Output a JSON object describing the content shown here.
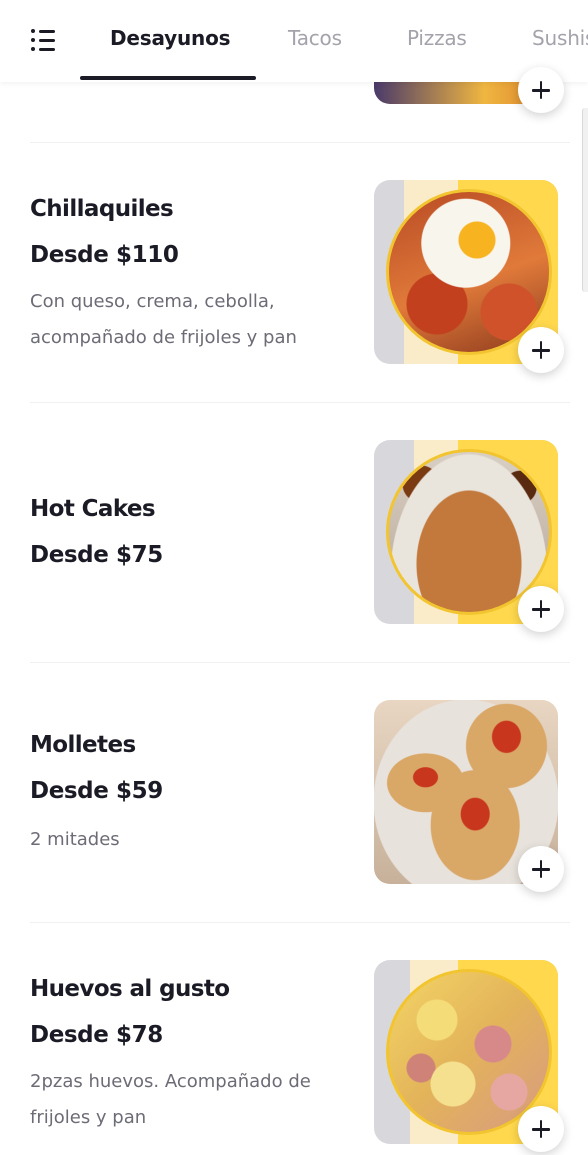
{
  "nav": {
    "tabs": [
      {
        "label": "Desayunos",
        "active": true
      },
      {
        "label": "Tacos",
        "active": false
      },
      {
        "label": "Pizzas",
        "active": false
      },
      {
        "label": "Sushis",
        "active": false
      }
    ]
  },
  "items": [
    {
      "name": "Chillaquiles",
      "price": "Desde $110",
      "description": "Con queso, crema, cebolla, acompañado de frijoles y pan",
      "image": "chilaquiles-photo"
    },
    {
      "name": "Hot Cakes",
      "price": "Desde $75",
      "description": "",
      "image": "hotcakes-photo"
    },
    {
      "name": "Molletes",
      "price": "Desde $59",
      "description": "2 mitades",
      "image": "molletes-photo"
    },
    {
      "name": "Huevos al gusto",
      "price": "Desde $78",
      "description": "2pzas huevos. Acompañado de frijoles y pan",
      "image": "huevos-photo"
    }
  ],
  "colors": {
    "accent_yellow": "#ffd84d",
    "text_dark": "#1b1b26",
    "text_muted": "#6c6c76",
    "tab_inactive": "#a3a3ab"
  },
  "icons": {
    "menu": "list-icon",
    "add": "plus-icon"
  }
}
